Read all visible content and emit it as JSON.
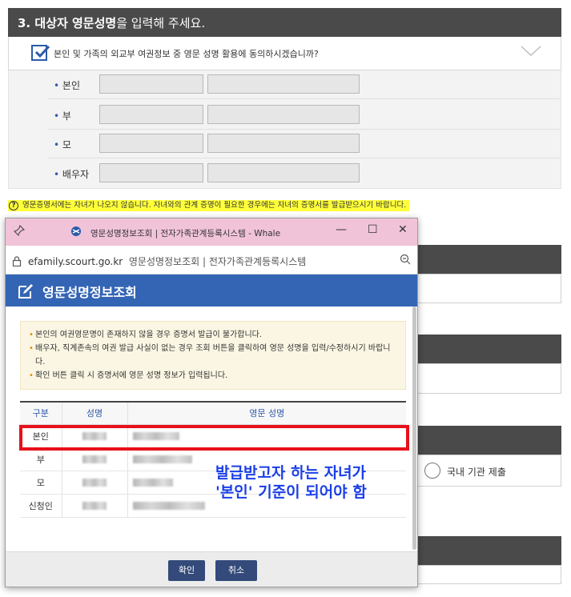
{
  "section": {
    "title_bold": "3. 대상자 영문성명",
    "title_rest": "을 입력해 주세요.",
    "agree_text": "본인 및 가족의 외교부 여권정보 중 영문 성명 활용에 동의하시겠습니까?",
    "agree_checked": true,
    "rows": [
      {
        "label": "본인"
      },
      {
        "label": "부"
      },
      {
        "label": "모"
      },
      {
        "label": "배우자"
      }
    ],
    "notice": "영문증명서에는 자녀가 나오지 않습니다. 자녀와의 관계 증명이 필요한 경우에는 자녀의 증명서를 발급받으시기 바랍니다.",
    "radio_label": "국내 기관 제출"
  },
  "popup": {
    "window_title": "영문성명정보조회 | 전자가족관계등록시스템 - Whale",
    "url_domain": "efamily.scourt.go.kr",
    "url_title": "영문성명정보조회 | 전자가족관계등록시스템",
    "header": "영문성명정보조회",
    "info": [
      "본인의 여권영문명이 존재하지 않을 경우 증명서 발급이 불가합니다.",
      "배우자, 직계존속의 여권 발급 사실이 없는 경우 조회 버튼을 클릭하여 영문 성명을 입력/수정하시기 바랍니다.",
      "확인 버튼 클릭 시 증명서에 영문 성명 정보가 입력됩니다."
    ],
    "table": {
      "headers": [
        "구분",
        "성명",
        "영문 성명"
      ],
      "rows": [
        {
          "type": "본인"
        },
        {
          "type": "부"
        },
        {
          "type": "모"
        },
        {
          "type": "신청인"
        }
      ]
    },
    "annotation_line1": "발급받고자 하는 자녀가",
    "annotation_line2": "'본인' 기준이 되어야 함",
    "confirm_label": "확인",
    "cancel_label": "취소"
  },
  "colors": {
    "header_dark": "#4a4a4a",
    "popup_titlebar": "#f1c3d9",
    "popup_header": "#3465b5",
    "highlight": "#e8101a",
    "annotation": "#1a3fe6",
    "notice_bg": "#ffff3a"
  }
}
